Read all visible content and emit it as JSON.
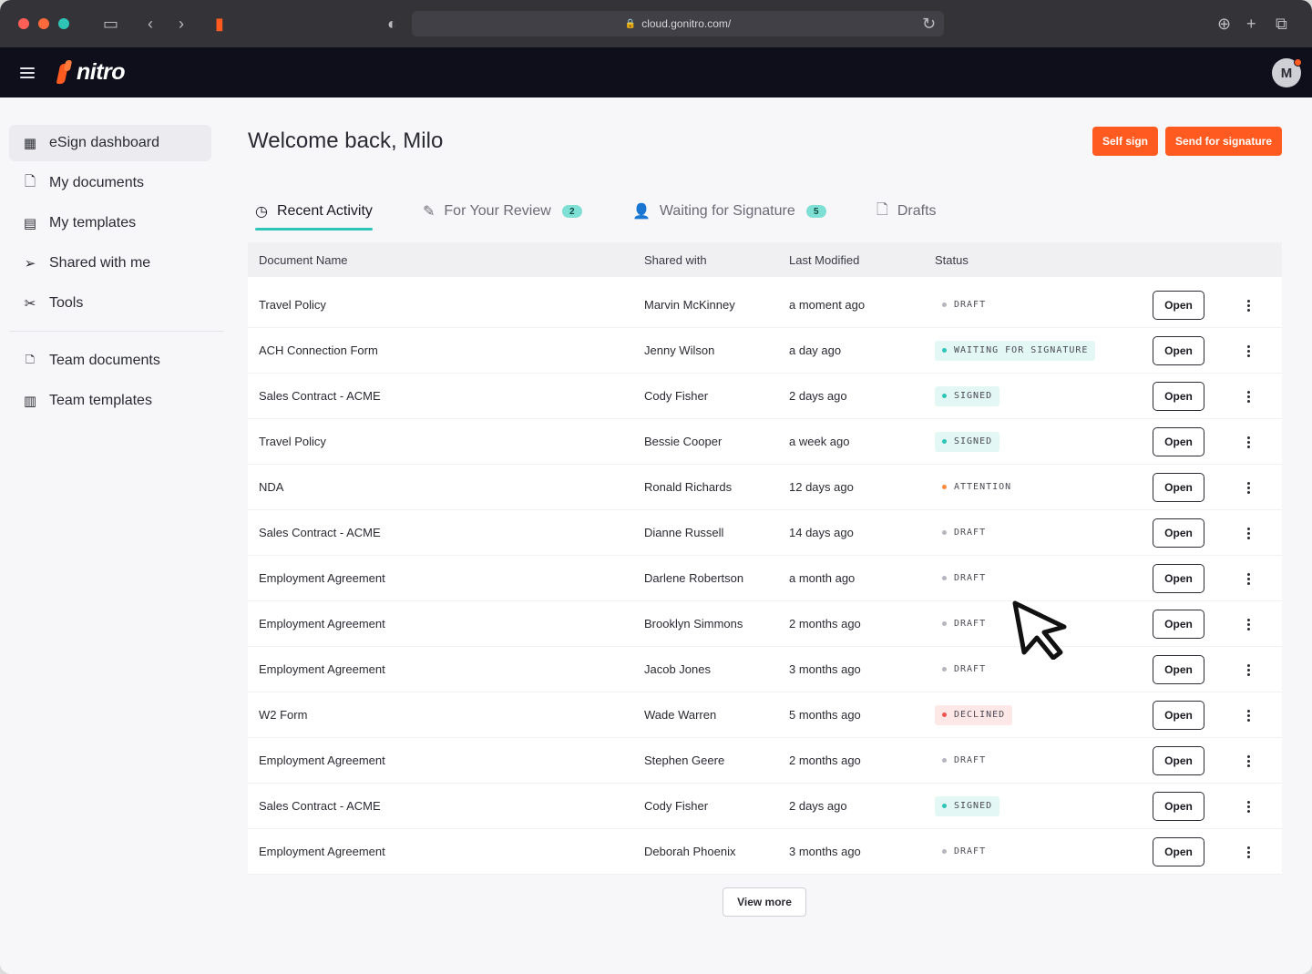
{
  "browser": {
    "url": "cloud.gonitro.com/",
    "traffic_lights": [
      "#ff5f57",
      "#ff6a3d",
      "#2ec4b6"
    ]
  },
  "app": {
    "logo_text": "nitro",
    "avatar_initial": "M",
    "brand_color": "#ff5a1f",
    "accent_color": "#2ec4b6"
  },
  "sidebar": {
    "items": [
      {
        "label": "eSign dashboard",
        "icon": "grid-icon",
        "glyph": "▦",
        "active": true
      },
      {
        "label": "My documents",
        "icon": "document-icon",
        "glyph": "🗋",
        "active": false
      },
      {
        "label": "My templates",
        "icon": "template-icon",
        "glyph": "▤",
        "active": false
      },
      {
        "label": "Shared with me",
        "icon": "send-icon",
        "glyph": "➢",
        "active": false
      },
      {
        "label": "Tools",
        "icon": "tools-icon",
        "glyph": "✂",
        "active": false
      }
    ],
    "team_items": [
      {
        "label": "Team documents",
        "icon": "team-documents-icon",
        "glyph": "🗅"
      },
      {
        "label": "Team templates",
        "icon": "team-templates-icon",
        "glyph": "▥"
      }
    ]
  },
  "main": {
    "title": "Welcome back, Milo",
    "self_sign_label": "Self sign",
    "send_label": "Send for signature",
    "tabs": [
      {
        "label": "Recent Activity",
        "icon": "clock-icon",
        "glyph": "◷",
        "badge": ""
      },
      {
        "label": "For Your Review",
        "icon": "pen-icon",
        "glyph": "✎",
        "badge": "2"
      },
      {
        "label": "Waiting for Signature",
        "icon": "user-clock-icon",
        "glyph": "👤",
        "badge": "5"
      },
      {
        "label": "Drafts",
        "icon": "draft-icon",
        "glyph": "🗋",
        "badge": ""
      }
    ],
    "columns": [
      "Document Name",
      "Shared with",
      "Last Modified",
      "Status"
    ],
    "open_label": "Open",
    "view_more_label": "View more",
    "rows": [
      {
        "name": "Travel Policy",
        "shared": "Marvin McKinney",
        "modified": "a moment ago",
        "status": "DRAFT"
      },
      {
        "name": "ACH Connection Form",
        "shared": "Jenny Wilson",
        "modified": "a day ago",
        "status": "WAITING FOR SIGNATURE"
      },
      {
        "name": "Sales Contract - ACME",
        "shared": "Cody Fisher",
        "modified": "2 days ago",
        "status": "SIGNED"
      },
      {
        "name": "Travel Policy",
        "shared": "Bessie Cooper",
        "modified": "a week ago",
        "status": "SIGNED"
      },
      {
        "name": "NDA",
        "shared": "Ronald Richards",
        "modified": "12 days ago",
        "status": "ATTENTION"
      },
      {
        "name": "Sales Contract - ACME",
        "shared": "Dianne Russell",
        "modified": "14 days ago",
        "status": "DRAFT"
      },
      {
        "name": "Employment Agreement",
        "shared": "Darlene Robertson",
        "modified": "a month ago",
        "status": "DRAFT"
      },
      {
        "name": "Employment Agreement",
        "shared": "Brooklyn Simmons",
        "modified": "2 months ago",
        "status": "DRAFT"
      },
      {
        "name": "Employment Agreement",
        "shared": "Jacob Jones",
        "modified": "3 months ago",
        "status": "DRAFT"
      },
      {
        "name": "W2 Form",
        "shared": "Wade Warren",
        "modified": "5 months ago",
        "status": "DECLINED"
      },
      {
        "name": "Employment Agreement",
        "shared": "Stephen Geere",
        "modified": "2 months ago",
        "status": "DRAFT"
      },
      {
        "name": "Sales Contract - ACME",
        "shared": "Cody Fisher",
        "modified": "2 days ago",
        "status": "SIGNED"
      },
      {
        "name": "Employment Agreement",
        "shared": "Deborah Phoenix",
        "modified": "3 months ago",
        "status": "DRAFT"
      }
    ],
    "status_styles": {
      "DRAFT": {
        "bg": "#ffffff",
        "dot": "#b5b5bd"
      },
      "WAITING FOR SIGNATURE": {
        "bg": "#e3f7f5",
        "dot": "#2ec4b6"
      },
      "SIGNED": {
        "bg": "#e3f7f5",
        "dot": "#2ec4b6"
      },
      "ATTENTION": {
        "bg": "#ffffff",
        "dot": "#ff8a3d"
      },
      "DECLINED": {
        "bg": "#fde7e7",
        "dot": "#f05252"
      }
    }
  }
}
